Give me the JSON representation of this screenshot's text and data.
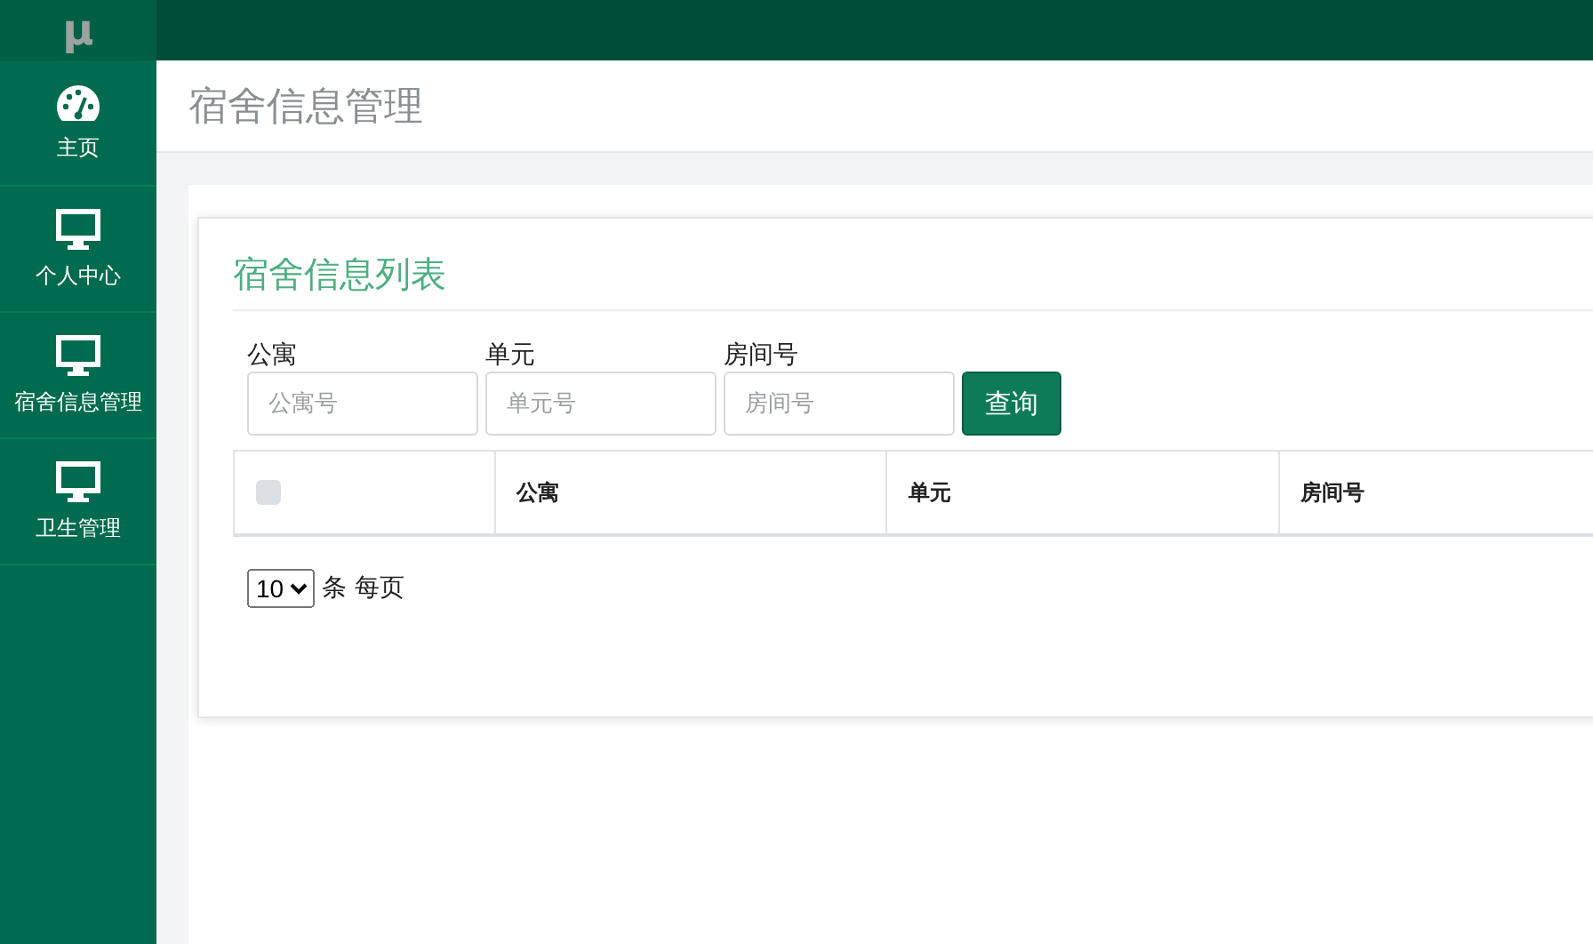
{
  "logo": "μ",
  "sidebar": {
    "items": [
      {
        "label": "主页",
        "kind": "dashboard",
        "selected": false
      },
      {
        "label": "个人中心",
        "kind": "monitor",
        "selected": false
      },
      {
        "label": "宿舍信息管理",
        "kind": "monitor",
        "selected": false
      },
      {
        "label": "卫生管理",
        "kind": "monitor",
        "selected": false
      }
    ]
  },
  "page_title": "宿舍信息管理",
  "card_title": "宿舍信息列表",
  "filters": [
    {
      "label": "公寓",
      "placeholder": "公寓号"
    },
    {
      "label": "单元",
      "placeholder": "单元号"
    },
    {
      "label": "房间号",
      "placeholder": "房间号"
    }
  ],
  "search_button": "查询",
  "table": {
    "select_all": {
      "checked": false
    },
    "columns": [
      "公寓",
      "单元",
      "房间号"
    ]
  },
  "page_size": {
    "value": "10",
    "suffix": "条 每页"
  }
}
